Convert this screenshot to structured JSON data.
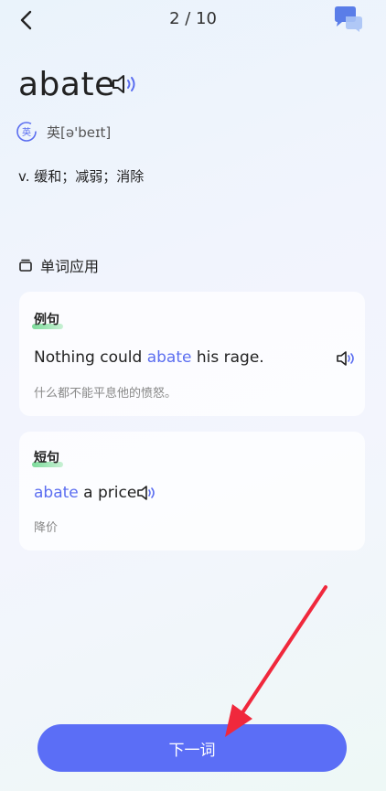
{
  "header": {
    "progress": "2 / 10"
  },
  "word": {
    "text": "abate",
    "phonetic": "英[ə'beɪt]",
    "phonetic_badge": "英",
    "meaning": "v. 缓和；减弱；消除"
  },
  "section": {
    "title": "单词应用"
  },
  "example_card": {
    "tag": "例句",
    "sentence_pre": "Nothing could ",
    "sentence_highlight": "abate",
    "sentence_post": " his rage.",
    "translation": "什么都不能平息他的愤怒。"
  },
  "phrase_card": {
    "tag": "短句",
    "phrase_highlight": "abate",
    "phrase_post": " a price",
    "translation": "降价"
  },
  "footer": {
    "next_label": "下一词"
  },
  "colors": {
    "accent": "#5b6ef6",
    "highlight_text": "#5b6ef0",
    "annotation_arrow": "#f0283c"
  },
  "icons": [
    "back-arrow-icon",
    "chat-bubbles-icon",
    "speaker-icon",
    "phonetic-badge-icon",
    "card-stack-icon"
  ]
}
